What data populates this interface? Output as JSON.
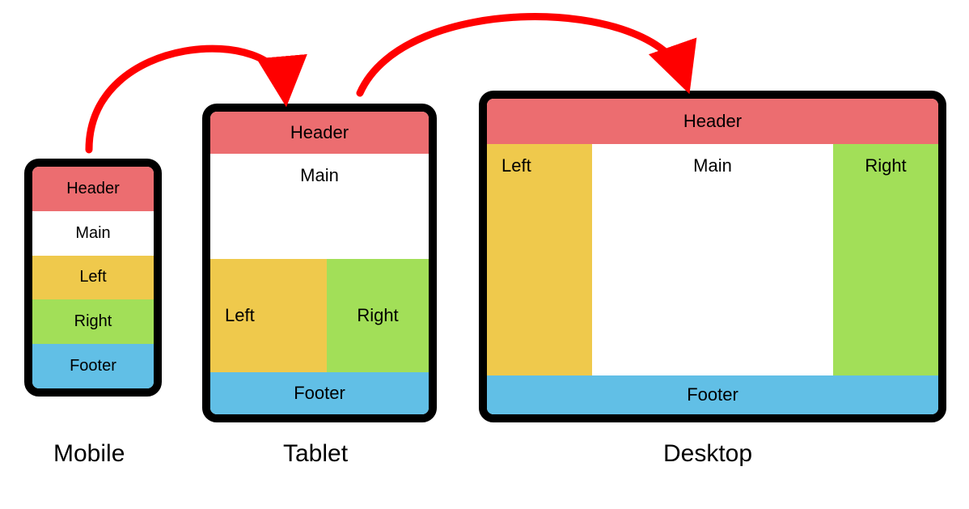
{
  "colors": {
    "header": "#ec6d70",
    "main": "#ffffff",
    "left": "#efc94c",
    "right": "#a2df58",
    "footer": "#61bfe6",
    "arrow": "#ff0000",
    "device_border": "#000000"
  },
  "regions": {
    "header": "Header",
    "main": "Main",
    "left": "Left",
    "right": "Right",
    "footer": "Footer"
  },
  "devices": {
    "mobile": {
      "caption": "Mobile",
      "layout": [
        "header",
        "main",
        "left",
        "right",
        "footer"
      ]
    },
    "tablet": {
      "caption": "Tablet",
      "layout_rows": [
        [
          "header"
        ],
        [
          "main"
        ],
        [
          "left",
          "right"
        ],
        [
          "footer"
        ]
      ]
    },
    "desktop": {
      "caption": "Desktop",
      "layout_rows": [
        [
          "header"
        ],
        [
          "left",
          "main",
          "right"
        ],
        [
          "footer"
        ]
      ]
    }
  },
  "arrows": [
    {
      "from": "mobile",
      "to": "tablet"
    },
    {
      "from": "tablet",
      "to": "desktop"
    }
  ]
}
